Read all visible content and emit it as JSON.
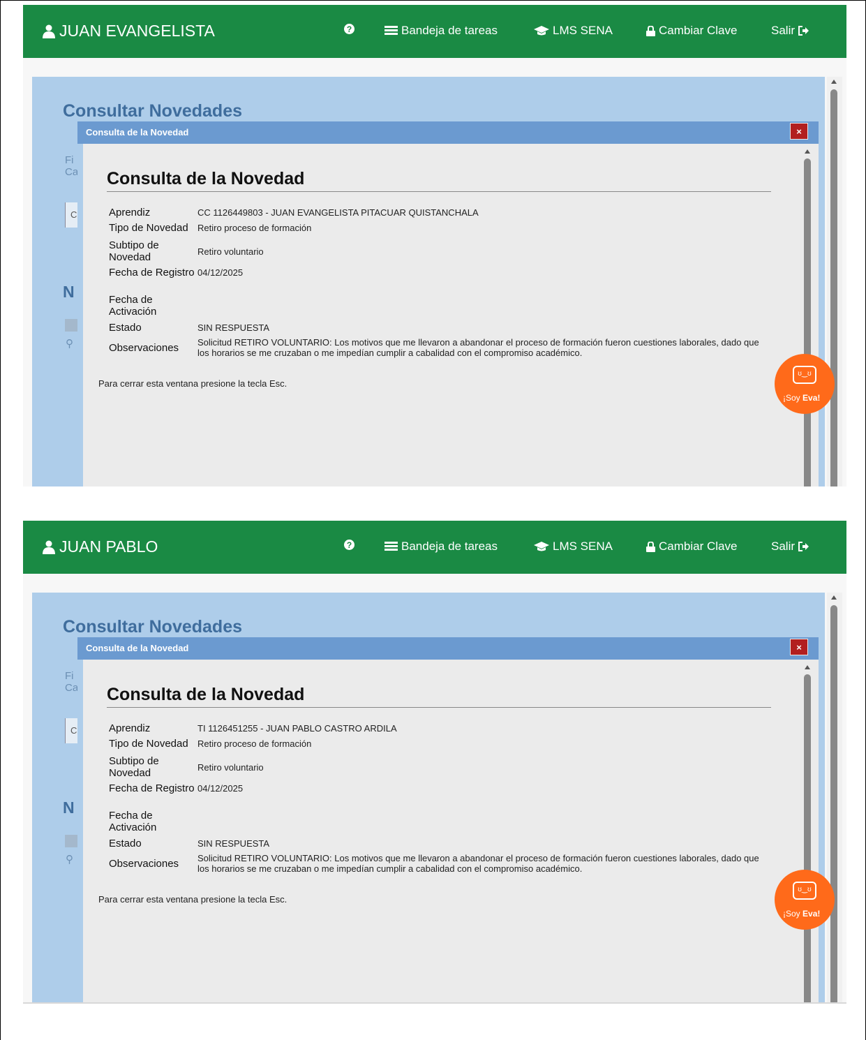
{
  "colors": {
    "topbar": "#1a8a44",
    "dialog_header": "#6b9ad0",
    "close_button": "#b21f1f",
    "assistant": "#ff6a1a",
    "background_panel": "#aecdea"
  },
  "icons": {
    "user": "user-icon",
    "help": "question-circle-icon",
    "tasks": "inbox-icon",
    "lms": "graduation-cap-icon",
    "password": "lock-icon",
    "logout": "sign-out-icon",
    "close": "close-icon"
  },
  "screens": [
    {
      "user_name": "JUAN EVANGELISTA",
      "nav": {
        "tasks": "Bandeja de tareas",
        "lms": "LMS SENA",
        "password": "Cambiar Clave",
        "logout": "Salir"
      },
      "page_title": "Consultar Novedades",
      "bg_fragments": {
        "f1": "Fi",
        "f2": "Ca",
        "f3": "C",
        "f4": "N"
      },
      "dialog": {
        "header": "Consulta de la Novedad",
        "close": "×",
        "heading": "Consulta de la Novedad",
        "fields": {
          "aprendiz_label": "Aprendiz",
          "aprendiz_value": "CC 1126449803 - JUAN EVANGELISTA PITACUAR QUISTANCHALA",
          "tipo_label": "Tipo de Novedad",
          "tipo_value": "Retiro proceso de formación",
          "subtipo_label": "Subtipo de Novedad",
          "subtipo_value": "Retiro voluntario",
          "registro_label": "Fecha de Registro",
          "registro_value": "04/12/2025",
          "activacion_label": "Fecha de Activación",
          "activacion_value": "",
          "estado_label": "Estado",
          "estado_value": "SIN RESPUESTA",
          "observaciones_label": "Observaciones",
          "observaciones_value": "Solicitud RETIRO VOLUNTARIO: Los motivos que me llevaron a abandonar el proceso de formación fueron cuestiones laborales, dado que los horarios se me cruzaban o me impedían cumplir a cabalidad con el compromiso académico."
        },
        "esc_note": "Para cerrar esta ventana presione la tecla Esc."
      },
      "assistant": {
        "prefix": "¡Soy ",
        "name": "Eva!"
      }
    },
    {
      "user_name": "JUAN PABLO",
      "nav": {
        "tasks": "Bandeja de tareas",
        "lms": "LMS SENA",
        "password": "Cambiar Clave",
        "logout": "Salir"
      },
      "page_title": "Consultar Novedades",
      "bg_fragments": {
        "f1": "Fi",
        "f2": "Ca",
        "f3": "C",
        "f4": "N"
      },
      "dialog": {
        "header": "Consulta de la Novedad",
        "close": "×",
        "heading": "Consulta de la Novedad",
        "fields": {
          "aprendiz_label": "Aprendiz",
          "aprendiz_value": "TI 1126451255 - JUAN PABLO CASTRO ARDILA",
          "tipo_label": "Tipo de Novedad",
          "tipo_value": "Retiro proceso de formación",
          "subtipo_label": "Subtipo de Novedad",
          "subtipo_value": "Retiro voluntario",
          "registro_label": "Fecha de Registro",
          "registro_value": "04/12/2025",
          "activacion_label": "Fecha de Activación",
          "activacion_value": "",
          "estado_label": "Estado",
          "estado_value": "SIN RESPUESTA",
          "observaciones_label": "Observaciones",
          "observaciones_value": "Solicitud RETIRO VOLUNTARIO: Los motivos que me llevaron a abandonar el proceso de formación fueron cuestiones laborales, dado que los horarios se me cruzaban o me impedían cumplir a cabalidad con el compromiso académico."
        },
        "esc_note": "Para cerrar esta ventana presione la tecla Esc."
      },
      "assistant": {
        "prefix": "¡Soy ",
        "name": "Eva!"
      }
    }
  ]
}
